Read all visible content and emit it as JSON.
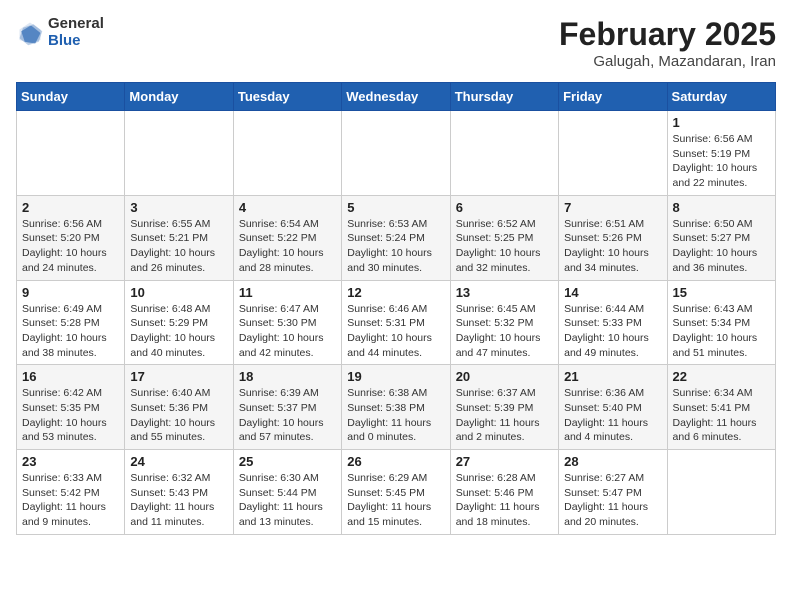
{
  "logo": {
    "general": "General",
    "blue": "Blue"
  },
  "title": "February 2025",
  "subtitle": "Galugah, Mazandaran, Iran",
  "weekdays": [
    "Sunday",
    "Monday",
    "Tuesday",
    "Wednesday",
    "Thursday",
    "Friday",
    "Saturday"
  ],
  "weeks": [
    [
      {
        "day": "",
        "info": ""
      },
      {
        "day": "",
        "info": ""
      },
      {
        "day": "",
        "info": ""
      },
      {
        "day": "",
        "info": ""
      },
      {
        "day": "",
        "info": ""
      },
      {
        "day": "",
        "info": ""
      },
      {
        "day": "1",
        "info": "Sunrise: 6:56 AM\nSunset: 5:19 PM\nDaylight: 10 hours and 22 minutes."
      }
    ],
    [
      {
        "day": "2",
        "info": "Sunrise: 6:56 AM\nSunset: 5:20 PM\nDaylight: 10 hours and 24 minutes."
      },
      {
        "day": "3",
        "info": "Sunrise: 6:55 AM\nSunset: 5:21 PM\nDaylight: 10 hours and 26 minutes."
      },
      {
        "day": "4",
        "info": "Sunrise: 6:54 AM\nSunset: 5:22 PM\nDaylight: 10 hours and 28 minutes."
      },
      {
        "day": "5",
        "info": "Sunrise: 6:53 AM\nSunset: 5:24 PM\nDaylight: 10 hours and 30 minutes."
      },
      {
        "day": "6",
        "info": "Sunrise: 6:52 AM\nSunset: 5:25 PM\nDaylight: 10 hours and 32 minutes."
      },
      {
        "day": "7",
        "info": "Sunrise: 6:51 AM\nSunset: 5:26 PM\nDaylight: 10 hours and 34 minutes."
      },
      {
        "day": "8",
        "info": "Sunrise: 6:50 AM\nSunset: 5:27 PM\nDaylight: 10 hours and 36 minutes."
      }
    ],
    [
      {
        "day": "9",
        "info": "Sunrise: 6:49 AM\nSunset: 5:28 PM\nDaylight: 10 hours and 38 minutes."
      },
      {
        "day": "10",
        "info": "Sunrise: 6:48 AM\nSunset: 5:29 PM\nDaylight: 10 hours and 40 minutes."
      },
      {
        "day": "11",
        "info": "Sunrise: 6:47 AM\nSunset: 5:30 PM\nDaylight: 10 hours and 42 minutes."
      },
      {
        "day": "12",
        "info": "Sunrise: 6:46 AM\nSunset: 5:31 PM\nDaylight: 10 hours and 44 minutes."
      },
      {
        "day": "13",
        "info": "Sunrise: 6:45 AM\nSunset: 5:32 PM\nDaylight: 10 hours and 47 minutes."
      },
      {
        "day": "14",
        "info": "Sunrise: 6:44 AM\nSunset: 5:33 PM\nDaylight: 10 hours and 49 minutes."
      },
      {
        "day": "15",
        "info": "Sunrise: 6:43 AM\nSunset: 5:34 PM\nDaylight: 10 hours and 51 minutes."
      }
    ],
    [
      {
        "day": "16",
        "info": "Sunrise: 6:42 AM\nSunset: 5:35 PM\nDaylight: 10 hours and 53 minutes."
      },
      {
        "day": "17",
        "info": "Sunrise: 6:40 AM\nSunset: 5:36 PM\nDaylight: 10 hours and 55 minutes."
      },
      {
        "day": "18",
        "info": "Sunrise: 6:39 AM\nSunset: 5:37 PM\nDaylight: 10 hours and 57 minutes."
      },
      {
        "day": "19",
        "info": "Sunrise: 6:38 AM\nSunset: 5:38 PM\nDaylight: 11 hours and 0 minutes."
      },
      {
        "day": "20",
        "info": "Sunrise: 6:37 AM\nSunset: 5:39 PM\nDaylight: 11 hours and 2 minutes."
      },
      {
        "day": "21",
        "info": "Sunrise: 6:36 AM\nSunset: 5:40 PM\nDaylight: 11 hours and 4 minutes."
      },
      {
        "day": "22",
        "info": "Sunrise: 6:34 AM\nSunset: 5:41 PM\nDaylight: 11 hours and 6 minutes."
      }
    ],
    [
      {
        "day": "23",
        "info": "Sunrise: 6:33 AM\nSunset: 5:42 PM\nDaylight: 11 hours and 9 minutes."
      },
      {
        "day": "24",
        "info": "Sunrise: 6:32 AM\nSunset: 5:43 PM\nDaylight: 11 hours and 11 minutes."
      },
      {
        "day": "25",
        "info": "Sunrise: 6:30 AM\nSunset: 5:44 PM\nDaylight: 11 hours and 13 minutes."
      },
      {
        "day": "26",
        "info": "Sunrise: 6:29 AM\nSunset: 5:45 PM\nDaylight: 11 hours and 15 minutes."
      },
      {
        "day": "27",
        "info": "Sunrise: 6:28 AM\nSunset: 5:46 PM\nDaylight: 11 hours and 18 minutes."
      },
      {
        "day": "28",
        "info": "Sunrise: 6:27 AM\nSunset: 5:47 PM\nDaylight: 11 hours and 20 minutes."
      },
      {
        "day": "",
        "info": ""
      }
    ]
  ]
}
